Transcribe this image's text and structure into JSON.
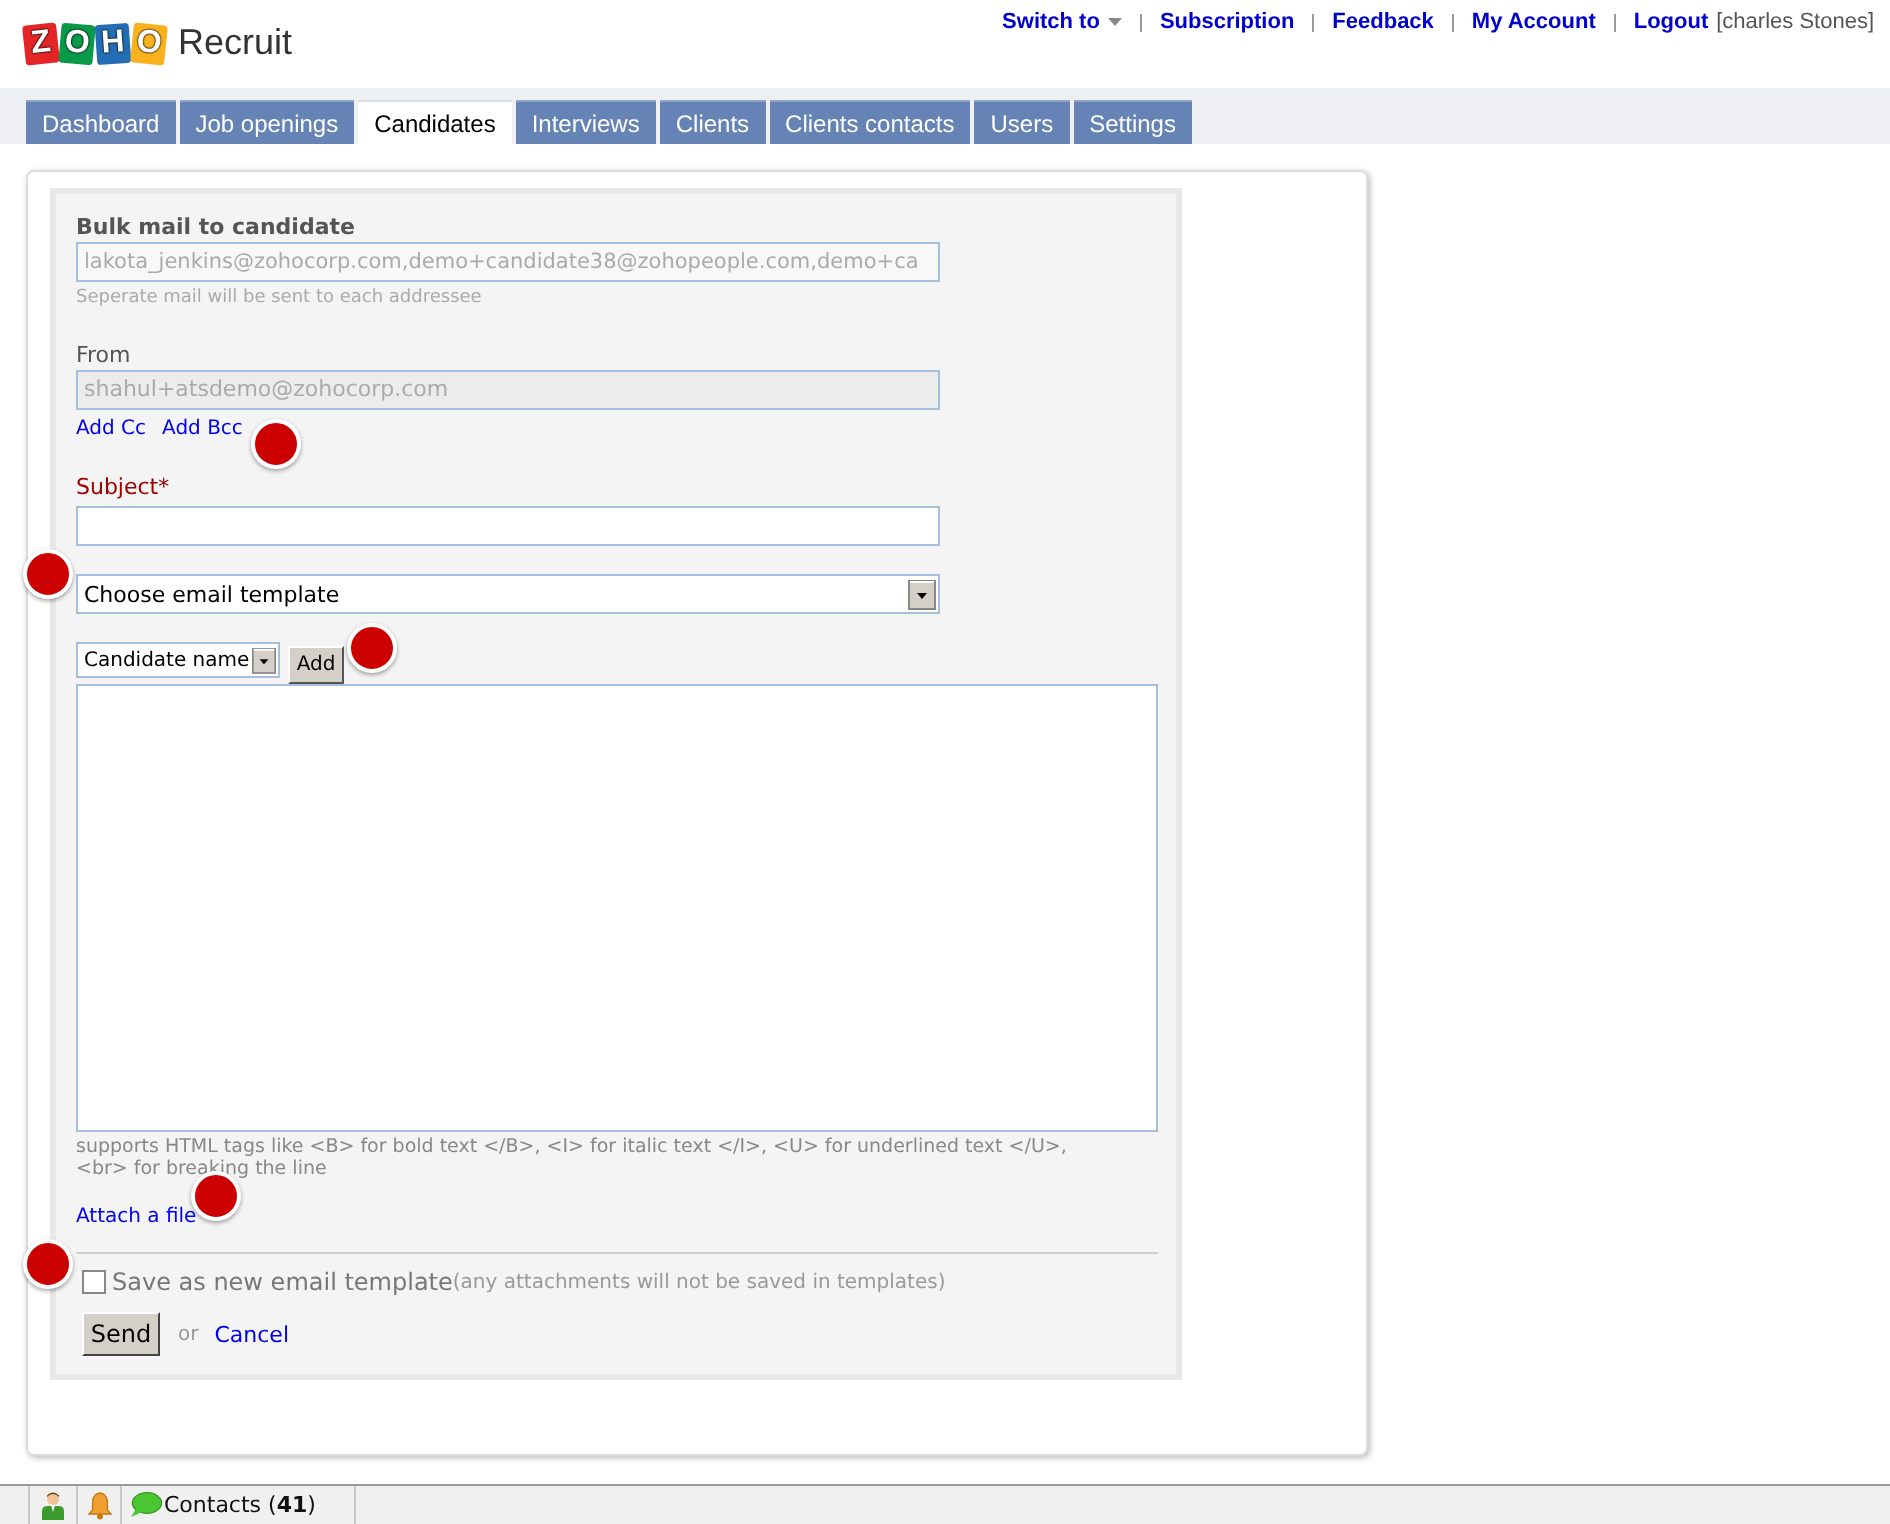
{
  "header": {
    "logo": {
      "letters": [
        {
          "letter": "Z",
          "color": "#e42527"
        },
        {
          "letter": "O",
          "color": "#089949"
        },
        {
          "letter": "H",
          "color": "#226db4"
        },
        {
          "letter": "O",
          "color": "#f9b21d"
        }
      ],
      "product": "Recruit"
    },
    "links": [
      {
        "label": "Switch to",
        "kind": "dropdown"
      },
      {
        "label": "Subscription",
        "kind": "link"
      },
      {
        "label": "Feedback",
        "kind": "link"
      },
      {
        "label": "My Account",
        "kind": "link"
      },
      {
        "label": "Logout",
        "kind": "link"
      }
    ],
    "user": "[charles Stones]"
  },
  "tabs": [
    {
      "label": "Dashboard",
      "selected": false
    },
    {
      "label": "Job openings",
      "selected": false
    },
    {
      "label": "Candidates",
      "selected": true
    },
    {
      "label": "Interviews",
      "selected": false
    },
    {
      "label": "Clients",
      "selected": false
    },
    {
      "label": "Clients contacts",
      "selected": false
    },
    {
      "label": "Users",
      "selected": false
    },
    {
      "label": "Settings",
      "selected": false
    }
  ],
  "form": {
    "title": "Bulk mail to candidate",
    "to": {
      "value": "lakota_jenkins@zohocorp.com,demo+candidate38@zohopeople.com,demo+ca",
      "hint": "Seperate mail will be sent to each addressee"
    },
    "from": {
      "label": "From",
      "value": "shahul+atsdemo@zohocorp.com"
    },
    "cc_links": [
      "Add Cc",
      "Add Bcc"
    ],
    "subject": {
      "label": "Subject*"
    },
    "template_select": {
      "value": "Choose email template"
    },
    "merge_field": {
      "value": "Candidate name",
      "button": "Add"
    },
    "body_hint": "supports HTML tags like <B> for bold text </B>, <I> for italic text </I>, <U> for underlined text </U>, <br> for breaking the line",
    "attach_link": "Attach a file",
    "save_template": {
      "checked": false,
      "label": "Save as new email template",
      "note": "(any attachments will not be saved in templates)"
    },
    "send_button": "Send",
    "or": "or",
    "cancel_link": "Cancel"
  },
  "status_bar": {
    "items": [
      {
        "kind": "person"
      },
      {
        "kind": "bell"
      },
      {
        "kind": "chat",
        "label": "Contacts (**41**)"
      }
    ]
  }
}
